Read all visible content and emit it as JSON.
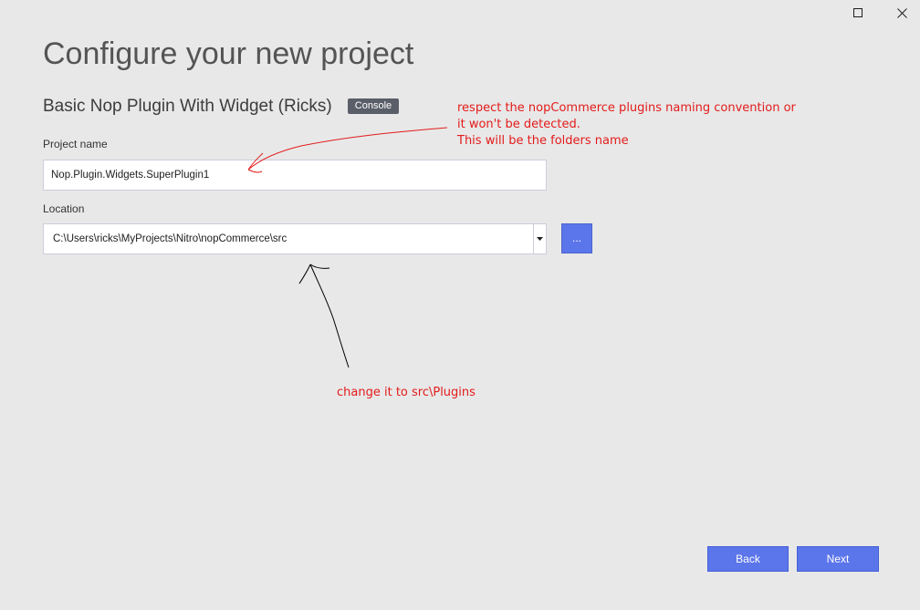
{
  "window": {
    "maximize_icon": "maximize-icon",
    "close_icon": "close-icon"
  },
  "page": {
    "title": "Configure your new project"
  },
  "template": {
    "name": "Basic Nop Plugin With Widget (Ricks)",
    "tag": "Console"
  },
  "project_name": {
    "label": "Project name",
    "value": "Nop.Plugin.Widgets.SuperPlugin1"
  },
  "location": {
    "label": "Location",
    "value": "C:\\Users\\ricks\\MyProjects\\Nitro\\nopCommerce\\src",
    "dropdown_icon": "caret-down-icon",
    "browse_label": "..."
  },
  "buttons": {
    "back": "Back",
    "next": "Next"
  },
  "annotations": {
    "naming_lines": [
      "respect the nopCommerce plugins naming convention or",
      "it won't be detected.",
      "This will be the folders name"
    ],
    "location_note": "change it to src\\Plugins",
    "red": "#e31b1b",
    "black": "#000000"
  },
  "colors": {
    "background": "#e8e8e8",
    "accent": "#5b75ea",
    "tag": "#5a5e68"
  }
}
